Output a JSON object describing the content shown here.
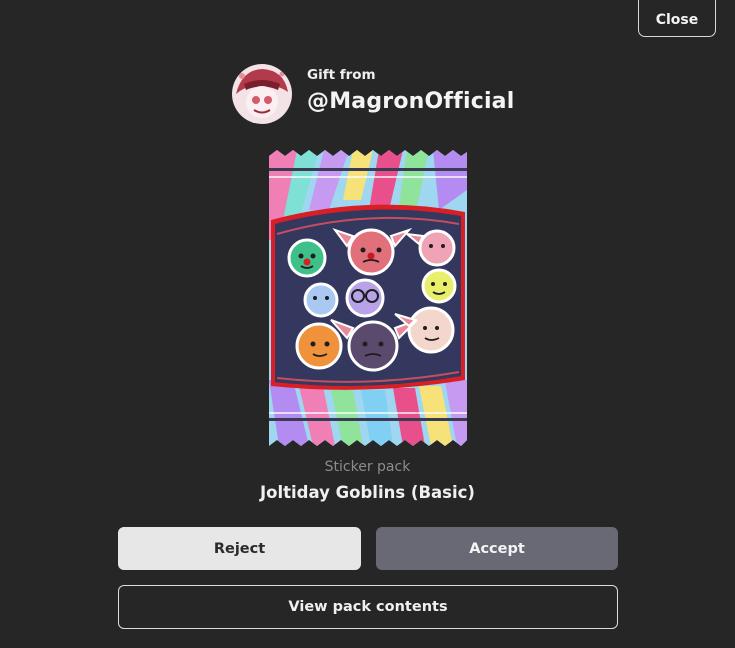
{
  "header": {
    "close_label": "Close"
  },
  "gift": {
    "from_label": "Gift from",
    "sender": "@MagronOfficial"
  },
  "pack": {
    "kind": "Sticker pack",
    "name": "Joltiday Goblins (Basic)"
  },
  "actions": {
    "reject_label": "Reject",
    "accept_label": "Accept",
    "view_contents_label": "View pack contents"
  },
  "colors": {
    "background": "#262626",
    "reject_bg": "#e7e7e7",
    "accept_bg": "#696976",
    "pack_red": "#d81f26"
  }
}
